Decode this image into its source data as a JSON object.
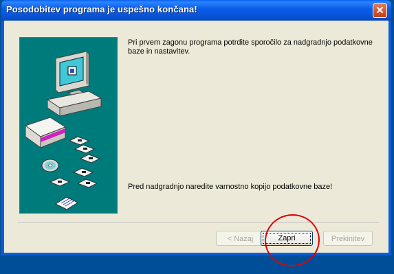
{
  "window": {
    "title": "Posodobitev programa je uspešno končana!",
    "close_symbol": "✕"
  },
  "content": {
    "message_top": "Pri prvem zagonu programa potrdite sporočilo za nadgradnjo podatkovne baze in nastavitev.",
    "message_bottom": "Pred nadgradnjo naredite varnostno kopijo podatkovne baze!"
  },
  "buttons": {
    "back_label": "< Nazaj",
    "finish_label": "Zapri",
    "cancel_label": "Prekinitev"
  },
  "icons": {
    "illustration": "computer-disks-illustration"
  },
  "colors": {
    "title_bar": "#0a5fd8",
    "illustration_bg": "#007b7b",
    "dialog_bg": "#ece9d8",
    "annotation": "#e00000"
  }
}
